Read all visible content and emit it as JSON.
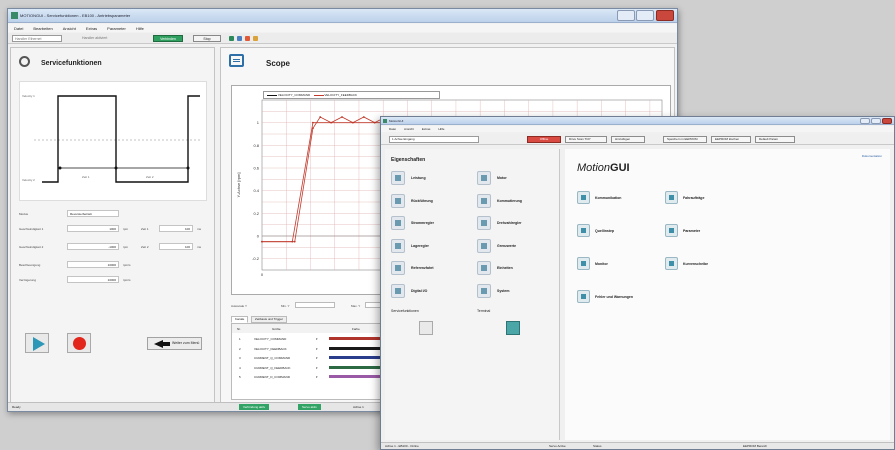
{
  "back_window": {
    "title": "MOTIONGUI - Servicefunktionen - EB100 - Antriebsparameter",
    "menu": [
      "Datei",
      "Bearbeiten",
      "Ansicht",
      "Extras",
      "Parameter",
      "Hilfe"
    ],
    "toolbar": {
      "combo": "Handler Ethernet",
      "checkbox_label": "Handler aktiviert",
      "connect_label": "Verbinden",
      "stop_label": "Stop"
    },
    "service": {
      "title": "Servicefunktionen",
      "profile_labels": {
        "v1": "Velocity 1",
        "v2": "Velocity 2",
        "t1": "Zeit 1",
        "t2": "Zeit 2"
      },
      "mode_label": "Modus",
      "mode_value": "Reversierbetrieb",
      "rows": [
        {
          "label": "Geschwindigkeit 1",
          "value": "1000",
          "unit": "rpm",
          "label2": "Zeit 1",
          "value2": "100",
          "unit2": "ms"
        },
        {
          "label": "Geschwindigkeit 2",
          "value": "-1000",
          "unit": "rpm",
          "label2": "Zeit 2",
          "value2": "100",
          "unit2": "ms"
        },
        {
          "label": "Beschleunigung",
          "value": "10000",
          "unit": "rpm/s",
          "label2": "",
          "value2": "",
          "unit2": ""
        },
        {
          "label": "Verzögerung",
          "value": "10000",
          "unit": "rpm/s",
          "label2": "",
          "value2": "",
          "unit2": ""
        }
      ],
      "next_label": "Weiter zum Menü"
    },
    "scope": {
      "title": "Scope",
      "legend": [
        "VELOCITY_COMMAND",
        "VELOCITY_FEEDBACK"
      ],
      "y_label": "Y-Achse [rpm]",
      "opts": [
        "Autoscale Y",
        "Min. Y",
        "Max. Y"
      ],
      "tabs": [
        "Kanäle",
        "Zeitbasis und Trigger"
      ],
      "table_headers": [
        "Nr.",
        "Größe",
        "Farbe"
      ],
      "channels": [
        {
          "nr": "1",
          "name": "VELOCITY_COMMAND",
          "color": "#b0342c"
        },
        {
          "nr": "2",
          "name": "VELOCITY_FEEDBACK",
          "color": "#1a1a1a"
        },
        {
          "nr": "3",
          "name": "CURRENT_Q_COMMAND",
          "color": "#2a3c8c"
        },
        {
          "nr": "4",
          "name": "CURRENT_Q_FEEDBACK",
          "color": "#2c6a44"
        },
        {
          "nr": "5",
          "name": "CURRENT_D_COMMAND",
          "color": "#9a5aa6"
        }
      ]
    },
    "status": {
      "left": "Ready",
      "pills": [
        "Verbindung aktiv",
        "Servo aktiv"
      ],
      "right": "Achse 1"
    }
  },
  "front_window": {
    "title": "MotionGUI",
    "menu": [
      "Datei",
      "Ansicht",
      "Extras",
      "Hilfe"
    ],
    "toolbar": {
      "combo": "1 Achse Eingang",
      "buttons": [
        "Offline",
        "Drive Scan TCP",
        "Hinzufügen",
        "Speichern in EEPROM",
        "EEPROM löschen",
        "Default Param"
      ]
    },
    "props_title": "Eigenschaften",
    "props_left": [
      "Leistung",
      "Rückführung",
      "Strommregler",
      "Lageregler",
      "Referenzfahrt",
      "Digital I/O"
    ],
    "props_right": [
      "Motor",
      "Kommutierung",
      "Drehzahlregler",
      "Grenzwerte",
      "Einheiten",
      "System"
    ],
    "service_label": "Servicefunktionen",
    "terminal_label": "Terminal",
    "brand_light": "Motion",
    "brand_bold": "GUI",
    "help_link": "Dokumentation",
    "main_left": [
      "Kommunikation",
      "Quellinstep",
      "Monitor",
      "Fehler und Warnungen"
    ],
    "main_right": [
      "Fahraufträge",
      "Parameter",
      "Kurvenscheibe"
    ],
    "status": [
      "Achse 1 - EB100 - Online",
      "Servo Active",
      "Status",
      "EEPROM Bereich"
    ]
  },
  "chart_data": {
    "type": "line",
    "title": "",
    "xlabel": "",
    "ylabel": "Y-Achse [rpm]",
    "xlim": [
      0,
      330
    ],
    "ylim": [
      -0.3,
      1.2
    ],
    "x_ticks": [
      0,
      100,
      200,
      300
    ],
    "y_ticks": [
      -0.2,
      0,
      0.2,
      0.4,
      0.6,
      0.8,
      1
    ],
    "grid": true,
    "legend_position": "top",
    "series": [
      {
        "name": "VELOCITY_COMMAND",
        "x": [
          0,
          25,
          42,
          310
        ],
        "values": [
          -0.05,
          -0.05,
          1.0,
          1.0
        ]
      },
      {
        "name": "VELOCITY_FEEDBACK",
        "x": [
          0,
          27,
          42,
          48,
          57,
          66,
          75,
          84,
          93,
          102,
          111,
          120,
          129,
          138,
          147,
          156,
          165,
          174,
          183,
          310
        ],
        "values": [
          -0.05,
          -0.05,
          0.95,
          1.05,
          1.0,
          1.05,
          1.0,
          1.05,
          1.0,
          1.05,
          1.0,
          1.05,
          1.0,
          1.05,
          1.0,
          1.05,
          1.0,
          1.05,
          1.0,
          1.0
        ]
      }
    ]
  }
}
